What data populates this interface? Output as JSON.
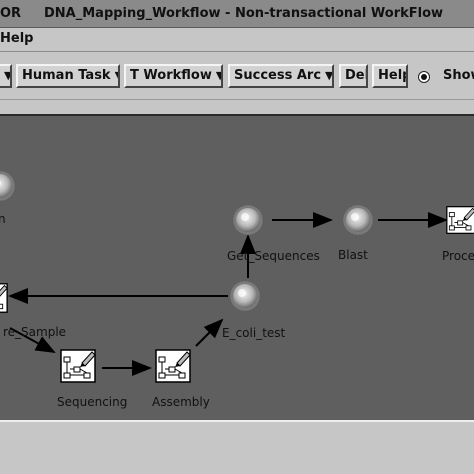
{
  "window": {
    "title_prefix": "OR",
    "title": "DNA_Mapping_Workflow - Non-transactional WorkFlow"
  },
  "menu": {
    "help_label": "Help"
  },
  "toolbar": {
    "human_task_label": "Human Task",
    "t_workflow_label": "T Workflow",
    "success_arc_label": "Success Arc",
    "del_label": "Del",
    "help_label": "Help",
    "show_label": "Show",
    "dropdown_arrow": "▼"
  },
  "nodes": {
    "get_sequences": "Get_Sequences",
    "blast": "Blast",
    "process": "Proce",
    "prepare_sample": "re_Sample",
    "e_coli_test": "E_coli_test",
    "sequencing": "Sequencing",
    "assembly": "Assembly",
    "left_top_label": "n"
  },
  "colors": {
    "canvas": "#5f5f5f",
    "title_bar": "#8a8a8a",
    "panel": "#c6c6c6"
  },
  "icons": {
    "transactional_task": "gear-sphere-icon",
    "workflow_task": "flowchart-pencil-icon"
  }
}
